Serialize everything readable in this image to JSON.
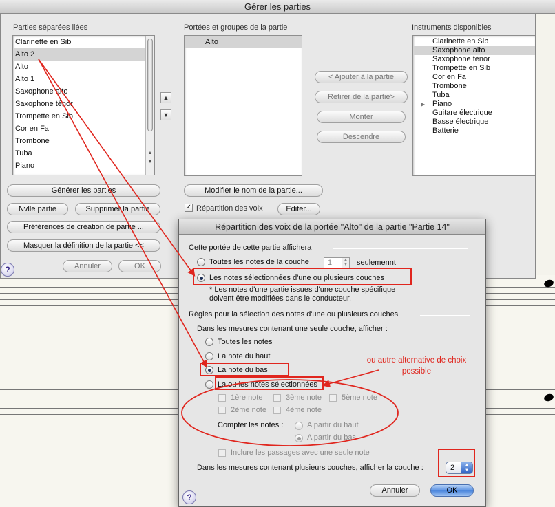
{
  "window": {
    "title": "Gérer les parties"
  },
  "parts_panel": {
    "label": "Parties séparées liées",
    "items": [
      "Clarinette en Sib",
      "Alto 2",
      "Alto",
      "Alto 1",
      "Saxophone alto",
      "Saxophone ténor",
      "Trompette en Sib",
      "Cor en Fa",
      "Trombone",
      "Tuba",
      "Piano"
    ],
    "selected_index": 1,
    "buttons": {
      "generate": "Générer les parties",
      "new_part": "Nvlle partie",
      "delete_part": "Supprimer la partie",
      "preferences": "Préférences de création de partie ...",
      "hide_definition": "Masquer la définition de la partie <<",
      "cancel": "Annuler",
      "ok": "OK"
    },
    "up_arrow": "▲",
    "down_arrow": "▼"
  },
  "staves_panel": {
    "label": "Portées et groupes de la partie",
    "items": [
      "Alto"
    ],
    "buttons": {
      "rename": "Modifier le nom de la partie...",
      "edit": "Editer..."
    },
    "voice_split_label": "Répartition des voix",
    "voice_split_checked": true
  },
  "middle_buttons": {
    "add": "< Ajouter à la partie",
    "remove": "Retirer de la partie>",
    "up": "Monter",
    "down": "Descendre"
  },
  "instruments_panel": {
    "label": "Instruments disponibles",
    "items": [
      "Clarinette en Sib",
      "Saxophone alto",
      "Saxophone ténor",
      "Trompette en Sib",
      "Cor en Fa",
      "Trombone",
      "Tuba",
      "Piano",
      "Guitare électrique",
      "Basse électrique",
      "Batterie"
    ],
    "selected_index": 1,
    "expandable_index": 7
  },
  "dialog": {
    "title": "Répartition des voix de la portée \"Alto\" de la partie \"Partie 14\"",
    "section1": "Cette portée de cette partie affichera",
    "opt_all_notes": "Toutes les notes de la couche",
    "layer_value": "1",
    "only_label": "seulemennt",
    "opt_selected": "Les notes sélectionnées d'une ou plusieurs couches",
    "footnote1": "* Les notes d'une partie issues d'une couche spécifique",
    "footnote2": "doivent être modifiées dans le conducteur.",
    "section2": "Règles pour la sélection des notes d'une ou plusieurs couches",
    "single_layer_label": "Dans les mesures contenant une seule couche, afficher :",
    "rule_all": "Toutes les notes",
    "rule_top": "La note du haut",
    "rule_bottom": "La note du bas",
    "rule_selected": "La ou les notes sélectionnées",
    "note1": "1ère note",
    "note2": "2ème note",
    "note3": "3ème note",
    "note4": "4ème note",
    "note5": "5ème note",
    "count_label": "Compter les notes :",
    "count_top": "A partir du haut",
    "count_bottom": "A partir du bas",
    "include_label": "Inclure les passages avec une seule note",
    "multi_layer_label": "Dans les mesures contenant plusieurs couches, afficher la couche :",
    "multi_layer_value": "2",
    "cancel": "Annuler",
    "ok": "OK",
    "help": "?"
  },
  "annotation": {
    "text_line1": "ou autre alternative de choix",
    "text_line2": "possible",
    "color": "#e0261e"
  },
  "colors": {
    "selection": "#d4d4d4",
    "ok_blue": "#4a85dc"
  }
}
